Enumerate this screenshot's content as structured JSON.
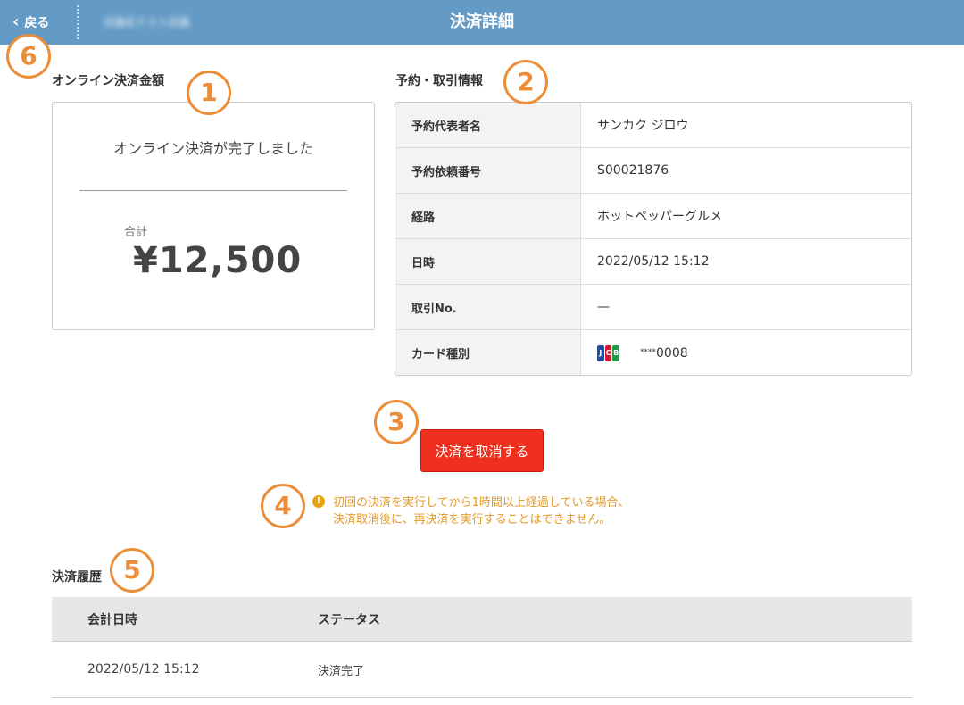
{
  "header": {
    "back_label": "戻る",
    "store_name": "店舗名テスト店舗",
    "title": "決済詳細"
  },
  "callouts": [
    "1",
    "2",
    "3",
    "4",
    "5",
    "6"
  ],
  "online_payment": {
    "section_title": "オンライン決済金額",
    "status": "オンライン決済が完了しました",
    "total_label": "合計",
    "total_value": "¥12,500"
  },
  "reservation": {
    "section_title": "予約・取引情報",
    "rows": [
      {
        "label": "予約代表者名",
        "value": "サンカク ジロウ"
      },
      {
        "label": "予約依頼番号",
        "value": "S00021876"
      },
      {
        "label": "経路",
        "value": "ホットペッパーグルメ"
      },
      {
        "label": "日時",
        "value": "2022/05/12 15:12"
      },
      {
        "label": "取引No.",
        "value": "—"
      },
      {
        "label": "カード種別",
        "card_brand": "JCB",
        "card_mask": "****",
        "card_last4": "0008"
      }
    ]
  },
  "cancel_button_label": "決済を取消する",
  "warning": {
    "line1": "初回の決済を実行してから1時間以上経過している場合、",
    "line2": "決済取消後に、再決済を実行することはできません。"
  },
  "history": {
    "section_title": "決済履歴",
    "columns": [
      "会計日時",
      "ステータス"
    ],
    "rows": [
      {
        "date": "2022/05/12 15:12",
        "status": "決済完了"
      }
    ]
  },
  "colors": {
    "header_bg": "#649bc6",
    "callout": "#ea8e3a",
    "cancel_button": "#f0301f",
    "warning_text": "#e39a2a"
  },
  "icons": {
    "back": "chevron-left-icon",
    "warning": "exclamation-circle-icon",
    "card": "jcb-logo-icon"
  }
}
